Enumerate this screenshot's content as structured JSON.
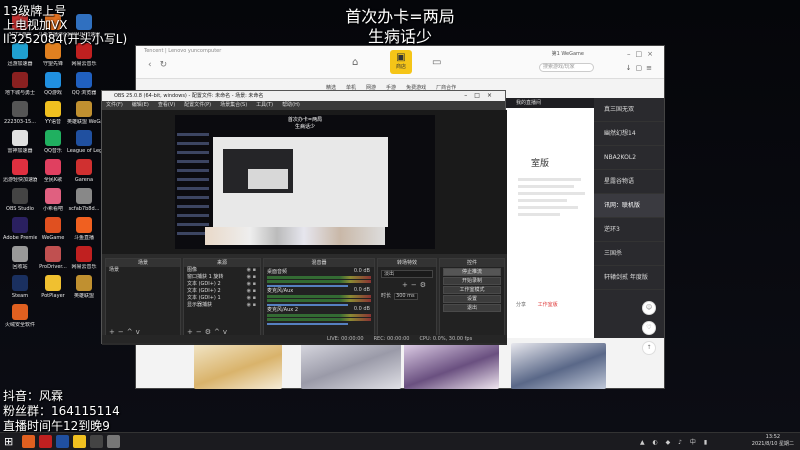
{
  "overlay": {
    "top_left": [
      "13级牌上号",
      "上电视加VX",
      "ll3252084(开头小写L)"
    ],
    "center": [
      "首次办卡=两局",
      "生病话少"
    ],
    "bottom_left": [
      "抖音：风霖",
      "粉丝群：164115114",
      "直播时间午12到晚9"
    ]
  },
  "desktop_icons": [
    {
      "label": "3GTX游戏",
      "color": "#c03030"
    },
    {
      "label": "斗鱼直播伴侣",
      "color": "#e07020"
    },
    {
      "label": "网易UU加速器",
      "color": "#3070c0"
    },
    {
      "label": "迅游加速器",
      "color": "#20a0d0"
    },
    {
      "label": "守望先锋",
      "color": "#e08020"
    },
    {
      "label": "网易云音乐",
      "color": "#c02020"
    },
    {
      "label": "地下城与勇士",
      "color": "#8a2020"
    },
    {
      "label": "QQ游戏",
      "color": "#2090e0"
    },
    {
      "label": "QQ 浏览器",
      "color": "#2060c0"
    },
    {
      "label": "222303-15...",
      "color": "#555555"
    },
    {
      "label": "YY语音",
      "color": "#f0c020"
    },
    {
      "label": "英雄联盟 WeGame版",
      "color": "#c09030"
    },
    {
      "label": "雷神加速器",
      "color": "#e0e0e0"
    },
    {
      "label": "QQ音乐",
      "color": "#20b060"
    },
    {
      "label": "League of Legends",
      "color": "#2050a0"
    },
    {
      "label": "迅游轻快加速器",
      "color": "#e03040"
    },
    {
      "label": "全民K歌",
      "color": "#e04060"
    },
    {
      "label": "Garena",
      "color": "#d03030"
    },
    {
      "label": "OBS Studio",
      "color": "#444444"
    },
    {
      "label": "小希看吧",
      "color": "#e06080"
    },
    {
      "label": "scfab7b8d...",
      "color": "#888888"
    },
    {
      "label": "Adobe Premie...",
      "color": "#2a2060"
    },
    {
      "label": "WeGame",
      "color": "#e05020"
    },
    {
      "label": "斗鱼直播",
      "color": "#f06020"
    },
    {
      "label": "回收站",
      "color": "#999999"
    },
    {
      "label": "ProDriver...",
      "color": "#c05050"
    },
    {
      "label": "网易云音乐",
      "color": "#c02020"
    },
    {
      "label": "Steam",
      "color": "#1a3060"
    },
    {
      "label": "PotPlayer",
      "color": "#f0c030"
    },
    {
      "label": "英雄联盟",
      "color": "#c09030"
    },
    {
      "label": "火绒安全软件",
      "color": "#e06020"
    }
  ],
  "wegame": {
    "brand": "Tencent  |  Lenovo  yuncomputer",
    "store_label": "商店",
    "user": "第1 WeGame",
    "search_placeholder": "搜索游戏/玩家",
    "tabs": [
      "精选",
      "单机",
      "网游",
      "手游",
      "免费游戏",
      "厂商合作"
    ],
    "panel_header": "我的直播间",
    "panel_title": "室版",
    "panel_buttons": [
      "分享",
      "工作室版"
    ],
    "side_list": [
      "真三国无双",
      "幽然幻想14",
      "NBA2KOL2",
      "星露谷物语",
      "讯网：联机版",
      "逆环3",
      "三国杀",
      "轩辕剑贰 年度版"
    ],
    "side_list_active": 4
  },
  "obs": {
    "title": "OBS 25.0.8 (64-bit, windows) - 配置文件: 未命名 - 场景: 未命名",
    "menu": [
      "文件(F)",
      "编辑(E)",
      "查看(V)",
      "配置文件(P)",
      "场景集合(S)",
      "工具(T)",
      "帮助(H)"
    ],
    "preview_text": [
      "首次办卡=两局",
      "生病话少"
    ],
    "docks": {
      "scenes": {
        "title": "场景",
        "items": [
          "场景"
        ]
      },
      "sources": {
        "title": "来源",
        "items": [
          "图像",
          "窗口捕获 1 旋转",
          "文本 (GDI+) 2",
          "文本 (GDI+) 2",
          "文本 (GDI+) 1",
          "显示器捕获"
        ]
      },
      "mixer": {
        "title": "混音器",
        "rows": [
          {
            "name": "桌面音频",
            "db": "0.0 dB"
          },
          {
            "name": "麦克风/Aux",
            "db": "0.0 dB"
          },
          {
            "name": "麦克风/Aux 2",
            "db": "0.0 dB"
          }
        ]
      },
      "transitions": {
        "title": "转场特效",
        "select": "淡出",
        "duration_label": "时长",
        "duration": "300 ms"
      },
      "controls": {
        "title": "控件",
        "buttons": [
          "停止推流",
          "开始录制",
          "工作室模式",
          "设置",
          "退出"
        ]
      }
    },
    "status": [
      "LIVE: 00:00:00",
      "REC: 00:00:00",
      "CPU: 0.0%, 30.00 fps"
    ]
  },
  "taskbar": {
    "apps": [
      "#e06020",
      "#c02020",
      "#2050a0",
      "#f0c020",
      "#444444",
      "#777777"
    ],
    "tray": "▲ ◐ ◆ ♪ 中 ▮",
    "time": "13:52",
    "date": "2021/8/10 星期二"
  }
}
